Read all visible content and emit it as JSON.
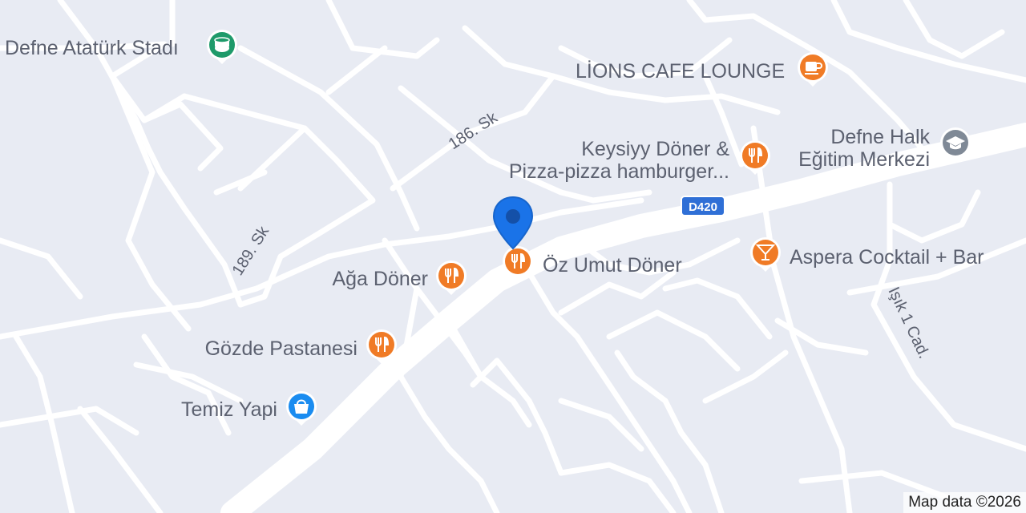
{
  "map": {
    "street_labels": [
      "186. Sk",
      "189. Sk",
      "Işık 1 Cad."
    ],
    "route_shield": "D420",
    "attribution": "Map data ©2026",
    "colors": {
      "background": "#e8ebf3",
      "road": "#ffffff",
      "poi_food": "#f07b26",
      "poi_stadium": "#1e9a6a",
      "poi_school": "#7f8996",
      "poi_shop": "#1a8cf0",
      "shield": "#2f6fd6",
      "location_pin": "#1a73e8"
    }
  },
  "pois": [
    {
      "id": "stadium",
      "label": "Defne Atatürk Stadı",
      "icon": "stadium-icon",
      "category": "stadium"
    },
    {
      "id": "lions",
      "label": "LİONS CAFE LOUNGE",
      "icon": "coffee-cup-icon",
      "category": "cafe"
    },
    {
      "id": "keysiyy",
      "label_line1": "Keysiyy Döner &",
      "label_line2": "Pizza-pizza hamburger...",
      "icon": "fork-knife-icon",
      "category": "restaurant"
    },
    {
      "id": "halk",
      "label_line1": "Defne Halk",
      "label_line2": "Eğitim Merkezi",
      "icon": "graduation-cap-icon",
      "category": "school"
    },
    {
      "id": "aspera",
      "label": "Aspera Cocktail + Bar",
      "icon": "cocktail-icon",
      "category": "bar"
    },
    {
      "id": "ozumut",
      "label": "Öz Umut Döner",
      "icon": "fork-knife-icon",
      "category": "restaurant"
    },
    {
      "id": "aga",
      "label": "Ağa Döner",
      "icon": "fork-knife-icon",
      "category": "restaurant"
    },
    {
      "id": "gozde",
      "label": "Gözde Pastanesi",
      "icon": "fork-knife-icon",
      "category": "restaurant"
    },
    {
      "id": "temiz",
      "label": "Temiz Yapi",
      "icon": "shopping-bag-icon",
      "category": "shop"
    }
  ]
}
